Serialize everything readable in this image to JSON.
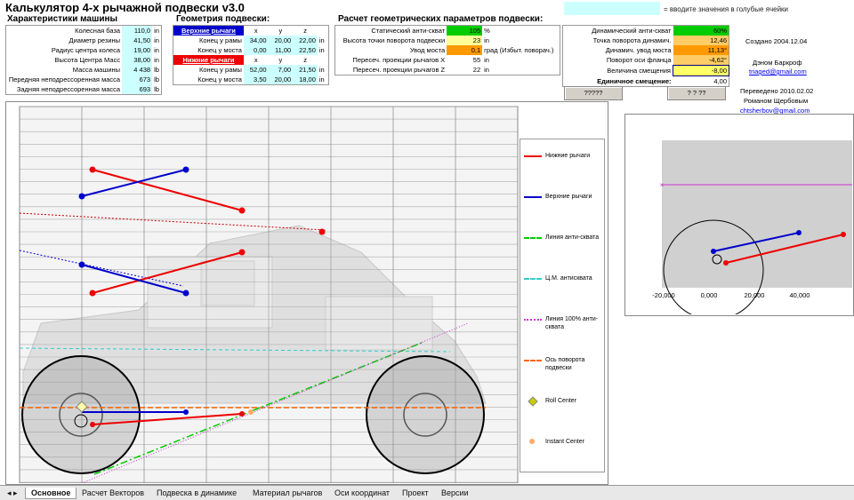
{
  "title": "Калькулятор 4-х рычажной подвески v3.0",
  "hint": "= вводите значения в голубые ячейки",
  "machine": {
    "header": "Характеристики машины",
    "rows": [
      {
        "label": "Колесная база",
        "value": "110,0",
        "unit": "in"
      },
      {
        "label": "Диаметр резины",
        "value": "41,50",
        "unit": "in"
      },
      {
        "label": "Радиус центра колеса",
        "value": "19,00",
        "unit": "in"
      },
      {
        "label": "Высота Центра Масс",
        "value": "38,00",
        "unit": "in"
      },
      {
        "label": "Масса машины",
        "value": "4 438",
        "unit": "lb"
      },
      {
        "label": "Передняя неподрессоренная масса",
        "value": "673",
        "unit": "lb"
      },
      {
        "label": "Задняя неподрессоренная масса",
        "value": "693",
        "unit": "lb"
      }
    ]
  },
  "geometry": {
    "header": "Геометрия подвески:",
    "upper_label": "Верхние рычаги",
    "lower_label": "Нижние рычаги",
    "col_x": "x",
    "col_y": "y",
    "col_z": "z",
    "upper_rows": [
      {
        "label": "Конец у рамы",
        "x": "34,00",
        "y": "20,00",
        "z": "22,00",
        "unit": "in"
      },
      {
        "label": "Конец у моста",
        "x": "0,00",
        "y": "11,00",
        "z": "22,50",
        "unit": "in"
      }
    ],
    "lower_rows": [
      {
        "label": "Конец у рамы",
        "x": "52,00",
        "y": "7,00",
        "z": "21,50",
        "unit": "in"
      },
      {
        "label": "Конец у моста",
        "x": "3,50",
        "y": "20,00",
        "z": "18,00",
        "unit": "in"
      }
    ]
  },
  "calc": {
    "header": "Расчет геометрических параметров подвески:",
    "left_rows": [
      {
        "label": "Статический анти-скват",
        "value": "105",
        "unit": "%",
        "color": "#00cc00"
      },
      {
        "label": "Высота точки поворота подвески",
        "value": "23",
        "unit": "in",
        "color": "#ffff99"
      },
      {
        "label": "Увод моста",
        "value": "0,1",
        "unit": "град (Избыт. поворач.)",
        "color": "#ff9900"
      },
      {
        "label": "Пересеч. проекции рычагов X",
        "value": "55",
        "unit": "in",
        "color": ""
      },
      {
        "label": "Пересеч. проекции рычагов Z",
        "value": "22",
        "unit": "in",
        "color": ""
      }
    ],
    "right_rows": [
      {
        "label": "Динамический анти-скват",
        "value": "60%",
        "color": "#00cc00"
      },
      {
        "label": "Точка поворота динамич.",
        "value": "12,46",
        "color": "#ffcc66"
      },
      {
        "label": "Динамич. увод моста",
        "value": "11,13°",
        "color": "#ff9900"
      },
      {
        "label": "Поворот оси фланца",
        "value": "-4,62°",
        "color": "#ffcc66"
      },
      {
        "label": "Величина смещения",
        "value": "-8,00",
        "color": "#ffff66"
      },
      {
        "label": "Единичное смещение:",
        "value": "4,00",
        "color": ""
      }
    ],
    "button1": "?????",
    "button2": "? ? ??"
  },
  "credits": {
    "created": "Создано 2004.12.04",
    "author": "Дэном Баркроф",
    "author_email": "triaged@gmail.com",
    "translated": "Переведено 2010.02.02",
    "translator": "Романом Щербовым",
    "translator_email": "chtsherbov@gmail.com"
  },
  "legend": [
    {
      "label": "Нижние рычаги",
      "color": "#ee0000",
      "style": "solid"
    },
    {
      "label": "Верхние рычаги",
      "color": "#0000cc",
      "style": "solid"
    },
    {
      "label": "Линия анти-сквата",
      "color": "#00cc00",
      "style": "dashdot"
    },
    {
      "label": "Ц.М. антисквата",
      "color": "#33cccc",
      "style": "dashed"
    },
    {
      "label": "Линия 100% анти-сквата",
      "color": "#cc33cc",
      "style": "dotted"
    },
    {
      "label": "Ось поворота подвески",
      "color": "#ff6600",
      "style": "dashed"
    },
    {
      "label": "Roll Center",
      "color": "#cccc00",
      "style": "diamond"
    },
    {
      "label": "Instant Center",
      "color": "#ffaa66",
      "style": "dot"
    }
  ],
  "side_chart": {
    "x_ticks": [
      "-20,000",
      "0,000",
      "20,000",
      "40,000"
    ]
  },
  "tabs": [
    "Основное",
    "Расчет Векторов",
    "Подвеска в динамике",
    "Материал рычагов",
    "Оси координат",
    "Проект",
    "Версии"
  ],
  "active_tab": "Основное"
}
